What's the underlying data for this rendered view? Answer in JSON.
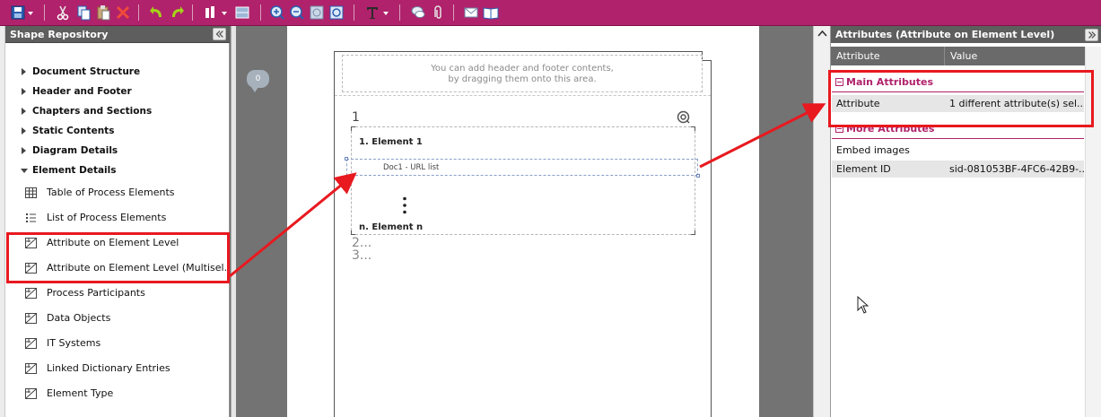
{
  "toolbar": {
    "buttons": [
      "save-icon",
      "cut-icon",
      "copy-icon",
      "paste-icon",
      "delete-icon",
      "undo-icon",
      "redo-icon",
      "align-icon",
      "distribute-icon",
      "zoom-in-icon",
      "zoom-out-icon",
      "zoom-fit-icon",
      "zoom-page-icon",
      "text-format-icon",
      "comment-icon",
      "attachment-icon",
      "email-icon",
      "book-icon"
    ],
    "accent": "#b0226b"
  },
  "repository": {
    "title": "Shape Repository",
    "categories": [
      {
        "label": "Document Structure",
        "expanded": false
      },
      {
        "label": "Header and Footer",
        "expanded": false
      },
      {
        "label": "Chapters and Sections",
        "expanded": false
      },
      {
        "label": "Static Contents",
        "expanded": false
      },
      {
        "label": "Diagram Details",
        "expanded": false
      },
      {
        "label": "Element Details",
        "expanded": true
      }
    ],
    "items": [
      {
        "label": "Table of Process Elements",
        "icon": "table-icon"
      },
      {
        "label": "List of Process Elements",
        "icon": "list-icon"
      },
      {
        "label": "Attribute on Element Level",
        "icon": "attribute-icon"
      },
      {
        "label": "Attribute on Element Level (Multisel...",
        "icon": "attribute-icon"
      },
      {
        "label": "Process Participants",
        "icon": "attribute-icon"
      },
      {
        "label": "Data Objects",
        "icon": "attribute-icon"
      },
      {
        "label": "IT Systems",
        "icon": "attribute-icon"
      },
      {
        "label": "Linked Dictionary Entries",
        "icon": "attribute-icon"
      },
      {
        "label": "Element Type",
        "icon": "attribute-icon"
      }
    ]
  },
  "canvas": {
    "comment_count": "0",
    "header_hint_1": "You can add header and footer contents,",
    "header_hint_2": "by dragging them onto this area.",
    "number_1": "1",
    "element_1": "1.  Element 1",
    "url_label": "Doc1 - URL list",
    "element_n": "n.  Element n",
    "number_2": "2...",
    "number_3": "3..."
  },
  "attributes": {
    "title": "Attributes (Attribute on Element Level)",
    "col_attribute": "Attribute",
    "col_value": "Value",
    "main_section": "Main Attributes",
    "main_rows": [
      {
        "key": "Attribute",
        "value": "1 different attribute(s) sel..."
      }
    ],
    "more_section": "More Attributes",
    "more_rows": [
      {
        "key": "Embed images",
        "value": ""
      },
      {
        "key": "Element ID",
        "value": "sid-081053BF-4FC6-42B9-..."
      }
    ]
  },
  "highlight_color": "#e8191f"
}
